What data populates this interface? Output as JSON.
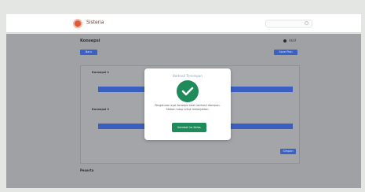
{
  "navbar": {
    "brand": "Sisteria",
    "search_placeholder": ""
  },
  "page": {
    "title": "Konsepsi",
    "legend_label": "Aktif",
    "left_button": "Baru",
    "right_button": "Save Plan",
    "panel_label_1": "Konsepsi 1",
    "panel_label_2": "Konsepsi 2",
    "submit_button": "Simpan",
    "footer_label": "Peserta"
  },
  "modal": {
    "title": "Berhasil Tersimpan",
    "message": "Pengaturan ayat konsepsi telah berhasil disimpan. Silakan tutup untuk melanjutkan.",
    "button": "Kembali ke Kelas"
  },
  "colors": {
    "accent": "#3a5fc0",
    "success": "#1f8a5a",
    "logo": "#e05a3a"
  }
}
